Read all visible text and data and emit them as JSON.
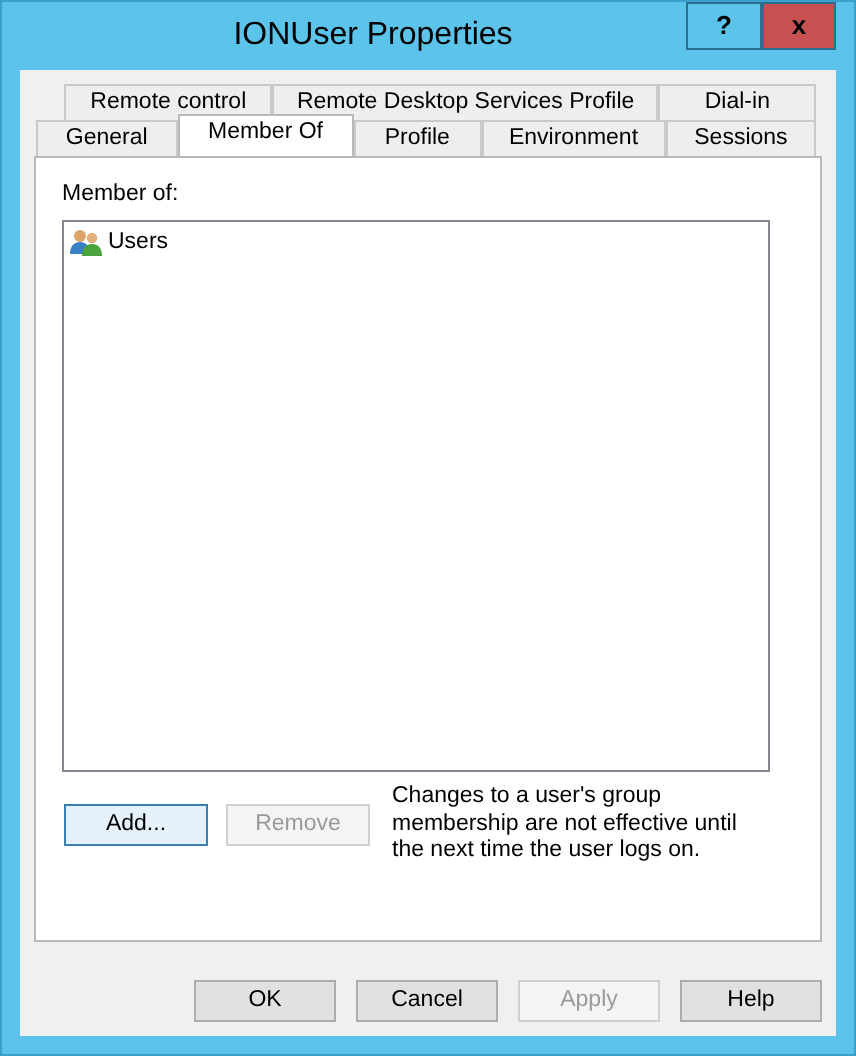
{
  "window": {
    "title": "IONUser Properties",
    "help_button": "?",
    "close_button": "x"
  },
  "tabs": [
    [
      {
        "label": "Remote control",
        "selected": false
      },
      {
        "label": "Remote Desktop Services Profile",
        "selected": false
      },
      {
        "label": "Dial-in",
        "selected": false
      }
    ],
    [
      {
        "label": "General",
        "selected": false
      },
      {
        "label": "Member Of",
        "selected": true
      },
      {
        "label": "Profile",
        "selected": false
      },
      {
        "label": "Environment",
        "selected": false
      },
      {
        "label": "Sessions",
        "selected": false
      }
    ]
  ],
  "member_of": {
    "label": "Member of:",
    "items": [
      {
        "name": "Users"
      }
    ]
  },
  "actions": [
    {
      "label": "Add...",
      "disabled": false
    },
    {
      "label": "Remove",
      "disabled": true
    }
  ],
  "note": "Changes to a user's group membership are not effective until the next time the user logs on.",
  "buttons": [
    {
      "label": "OK",
      "disabled": false
    },
    {
      "label": "Cancel",
      "disabled": false
    },
    {
      "label": "Apply",
      "disabled": true
    },
    {
      "label": "Help",
      "disabled": false
    }
  ]
}
